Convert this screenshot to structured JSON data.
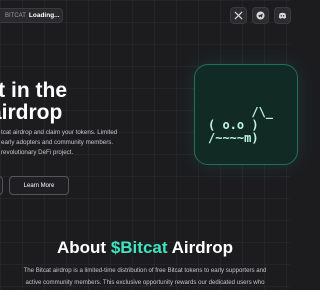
{
  "header": {
    "brand_fragment": "BITCAT",
    "status": "Loading...",
    "social": [
      "x-icon",
      "telegram-icon",
      "discord-icon"
    ]
  },
  "hero": {
    "title_line1": "rt in the",
    "title_line2": "airdrop",
    "description": [
      "tcat airdrop and claim your tokens. Limited",
      "early adopters and community members.",
      "revolutionary DeFi project."
    ],
    "learn_more_label": "Learn More"
  },
  "art": {
    "ascii_line1": "      /\\_",
    "ascii_line2": "( o.o )",
    "ascii_line3": "/~~~~m)"
  },
  "about": {
    "title_prefix": "About ",
    "title_brand": "$Bitcat",
    "title_suffix": " Airdrop",
    "body_line1": "The Bitcat airdrop is a limited-time distribution of free Bitcat tokens to early supporters and",
    "body_line2": "active community members. This exclusive opportunity rewards our dedicated users who"
  },
  "colors": {
    "accent": "#3fe4c0",
    "background": "#1c1c1f",
    "card_bg": "#122a24"
  }
}
